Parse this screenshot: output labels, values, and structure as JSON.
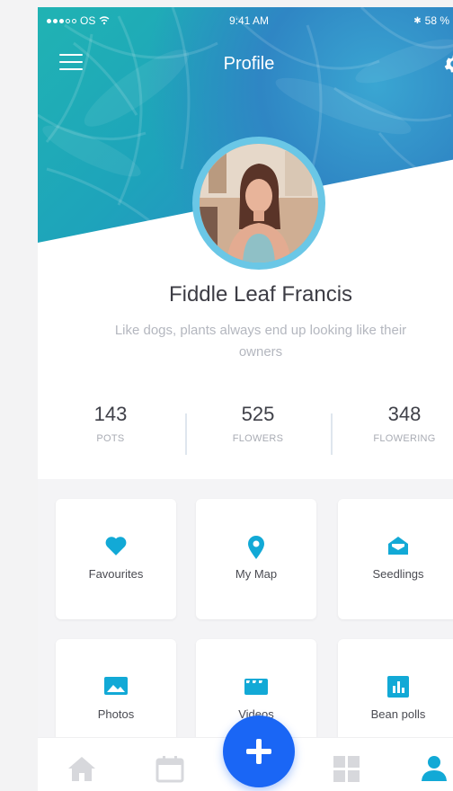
{
  "status_bar": {
    "carrier": "OS",
    "time": "9:41 AM",
    "battery": "58 %"
  },
  "header": {
    "title": "Profile"
  },
  "profile": {
    "name": "Fiddle Leaf Francis",
    "bio": "Like dogs, plants always end up looking like their owners"
  },
  "stats": [
    {
      "value": "143",
      "label": "POTS"
    },
    {
      "value": "525",
      "label": "FLOWERS"
    },
    {
      "value": "348",
      "label": "FLOWERING"
    }
  ],
  "tiles": [
    {
      "label": "Favourites",
      "icon": "heart-icon"
    },
    {
      "label": "My Map",
      "icon": "map-pin-icon"
    },
    {
      "label": "Seedlings",
      "icon": "mail-open-icon"
    },
    {
      "label": "Photos",
      "icon": "photo-icon"
    },
    {
      "label": "Videos",
      "icon": "video-icon"
    },
    {
      "label": "Bean polls",
      "icon": "bar-chart-icon"
    }
  ],
  "tabbar": {
    "items": [
      "home-icon",
      "calendar-icon",
      "add-icon",
      "grid-icon",
      "user-icon"
    ],
    "active": "user-icon"
  },
  "colors": {
    "accent": "#1a66f5",
    "icon_teal": "#12a9d6",
    "tab_inactive": "#d7d8dc"
  }
}
